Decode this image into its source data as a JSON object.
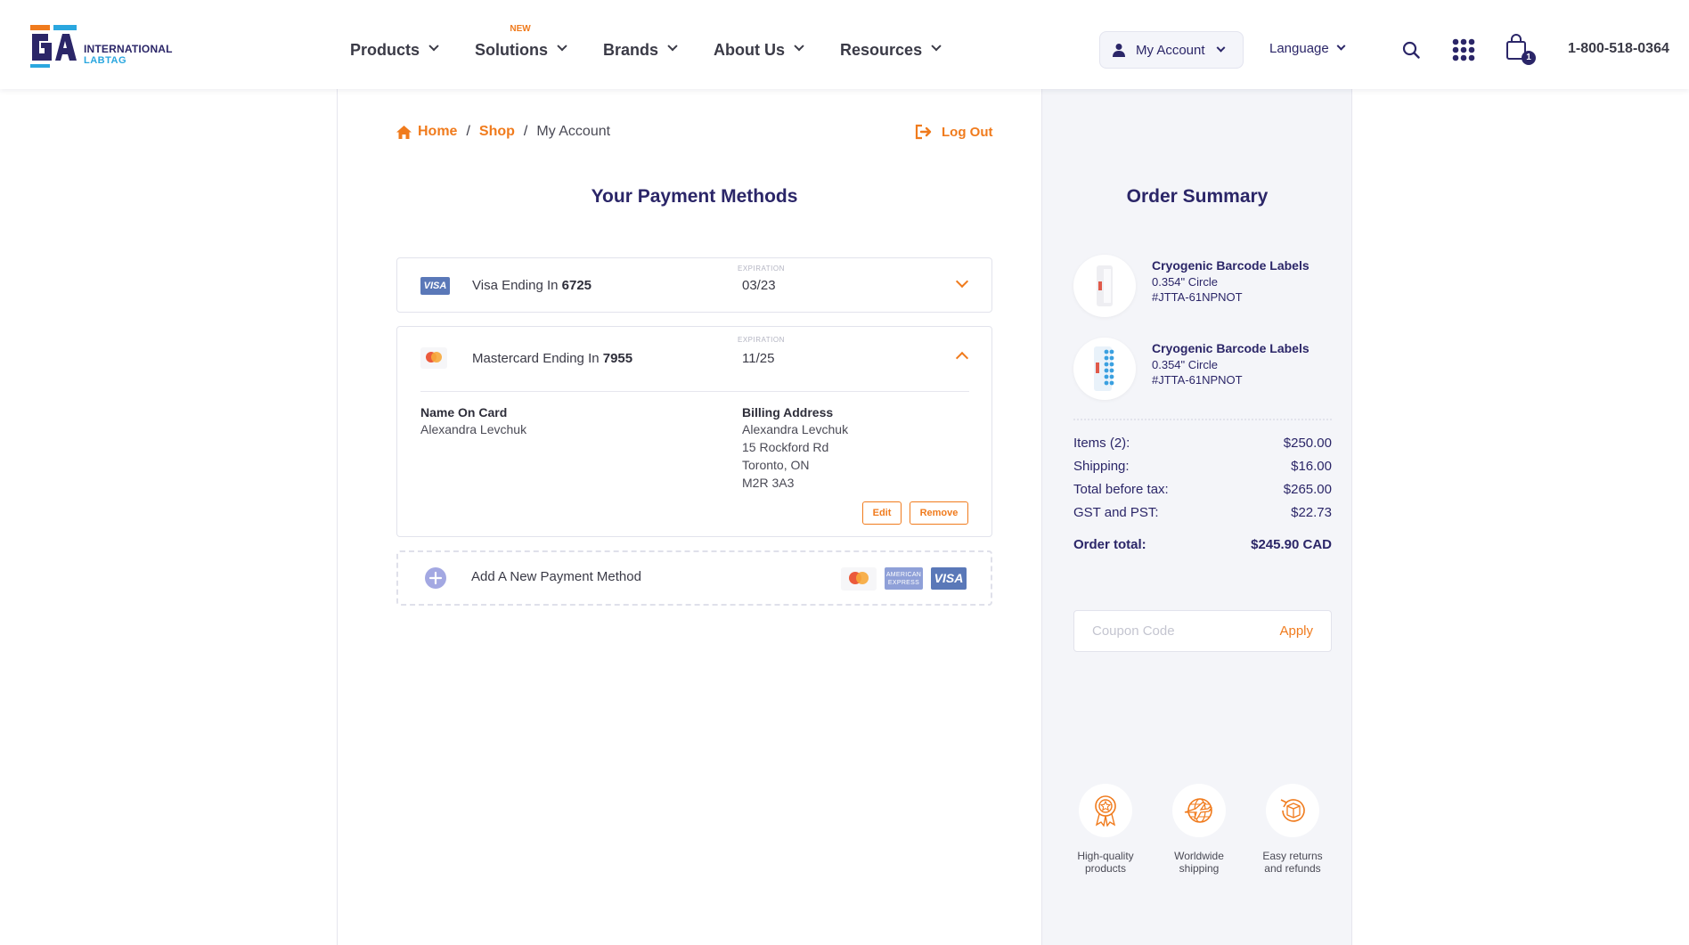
{
  "header": {
    "logo": {
      "line1": "INTERNATIONAL",
      "line2": "LABTAG",
      "icon": "ga-logo-icon"
    },
    "nav": [
      {
        "label": "Products",
        "badge": ""
      },
      {
        "label": "Solutions",
        "badge": "NEW"
      },
      {
        "label": "Brands",
        "badge": ""
      },
      {
        "label": "About Us",
        "badge": ""
      },
      {
        "label": "Resources",
        "badge": ""
      }
    ],
    "account_label": "My Account",
    "language_label": "Language",
    "cart_count": "1",
    "phone": "1-800-518-0364"
  },
  "breadcrumb": {
    "home": "Home",
    "shop": "Shop",
    "current": "My Account",
    "sep": "/"
  },
  "logout_label": "Log Out",
  "payment": {
    "title": "Your Payment Methods",
    "expiration_caption": "EXPIRATION",
    "cards": [
      {
        "brand": "visa",
        "label": "Visa Ending In ",
        "last4": "6725",
        "expiration": "03/23",
        "expanded": false
      },
      {
        "brand": "mastercard",
        "label": "Mastercard Ending In ",
        "last4": "7955",
        "expiration": "11/25",
        "expanded": true
      }
    ],
    "details": {
      "name_heading": "Name On Card",
      "name": "Alexandra Levchuk",
      "billing_heading": "Billing Address",
      "billing_lines": [
        "Alexandra Levchuk",
        "15 Rockford Rd",
        "Toronto, ON",
        "M2R 3A3"
      ],
      "edit_label": "Edit",
      "remove_label": "Remove"
    },
    "add_label": "Add A New Payment Method",
    "visa_text": "VISA",
    "amex_text": "AMERICAN EXPRESS"
  },
  "summary": {
    "title": "Order Summary",
    "items": [
      {
        "name": "Cryogenic Barcode Labels",
        "size": "0.354\" Circle",
        "sku": "#JTTA-61NPNOT"
      },
      {
        "name": "Cryogenic Barcode Labels",
        "size": "0.354\" Circle",
        "sku": "#JTTA-61NPNOT"
      }
    ],
    "rows": [
      {
        "label": "Items (2):",
        "value": "$250.00"
      },
      {
        "label": "Shipping:",
        "value": "$16.00"
      },
      {
        "label": "Total before tax:",
        "value": "$265.00"
      },
      {
        "label": "GST and PST:",
        "value": "$22.73"
      }
    ],
    "total": {
      "label": "Order total:",
      "value": "$245.90 CAD"
    },
    "coupon": {
      "placeholder": "Coupon Code",
      "apply_label": "Apply"
    },
    "features": [
      {
        "line1": "High-quality",
        "line2": "products",
        "icon": "award-badge-icon"
      },
      {
        "line1": "Worldwide",
        "line2": "shipping",
        "icon": "globe-plane-icon"
      },
      {
        "line1": "Easy returns",
        "line2": "and refunds",
        "icon": "return-box-icon"
      }
    ]
  },
  "colors": {
    "accent": "#f07b1d",
    "brand": "#2b2668",
    "aside_bg": "#f4f5f9",
    "visa_blue": "#5a78b8"
  }
}
